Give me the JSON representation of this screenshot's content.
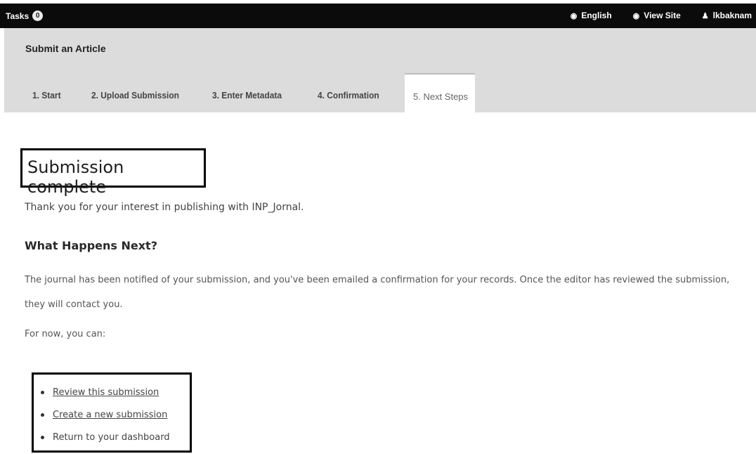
{
  "topbar": {
    "tasks_label": "Tasks",
    "tasks_count": "0",
    "links": [
      {
        "icon": "globe-icon",
        "glyph": "◉",
        "label": "English"
      },
      {
        "icon": "eye-icon",
        "glyph": "◉",
        "label": "View Site"
      },
      {
        "icon": "user-icon",
        "glyph": "♟",
        "label": "lkbaknam"
      }
    ]
  },
  "header": {
    "title": "Submit an Article",
    "tabs": [
      {
        "label": "1. Start"
      },
      {
        "label": "2. Upload Submission"
      },
      {
        "label": "3. Enter Metadata"
      },
      {
        "label": "4. Confirmation"
      },
      {
        "label": "5. Next Steps",
        "active": true
      }
    ]
  },
  "main": {
    "title": "Submission complete",
    "thanks": "Thank you for your interest in publishing with INP_Jornal.",
    "next_heading": "What Happens Next?",
    "notified": "The journal has been notified of your submission, and you've been emailed a confirmation for your records. Once the editor has reviewed the submission, they will contact you.",
    "for_now": "For now, you can:",
    "actions": [
      {
        "label": "Review this submission",
        "link": true
      },
      {
        "label": "Create a new submission",
        "link": true
      },
      {
        "label": "Return to your dashboard",
        "link": false
      }
    ]
  },
  "colors": {
    "topbar_bg": "#0b0b0b",
    "header_bg": "#dcdcdc",
    "highlight_border": "#000000"
  }
}
